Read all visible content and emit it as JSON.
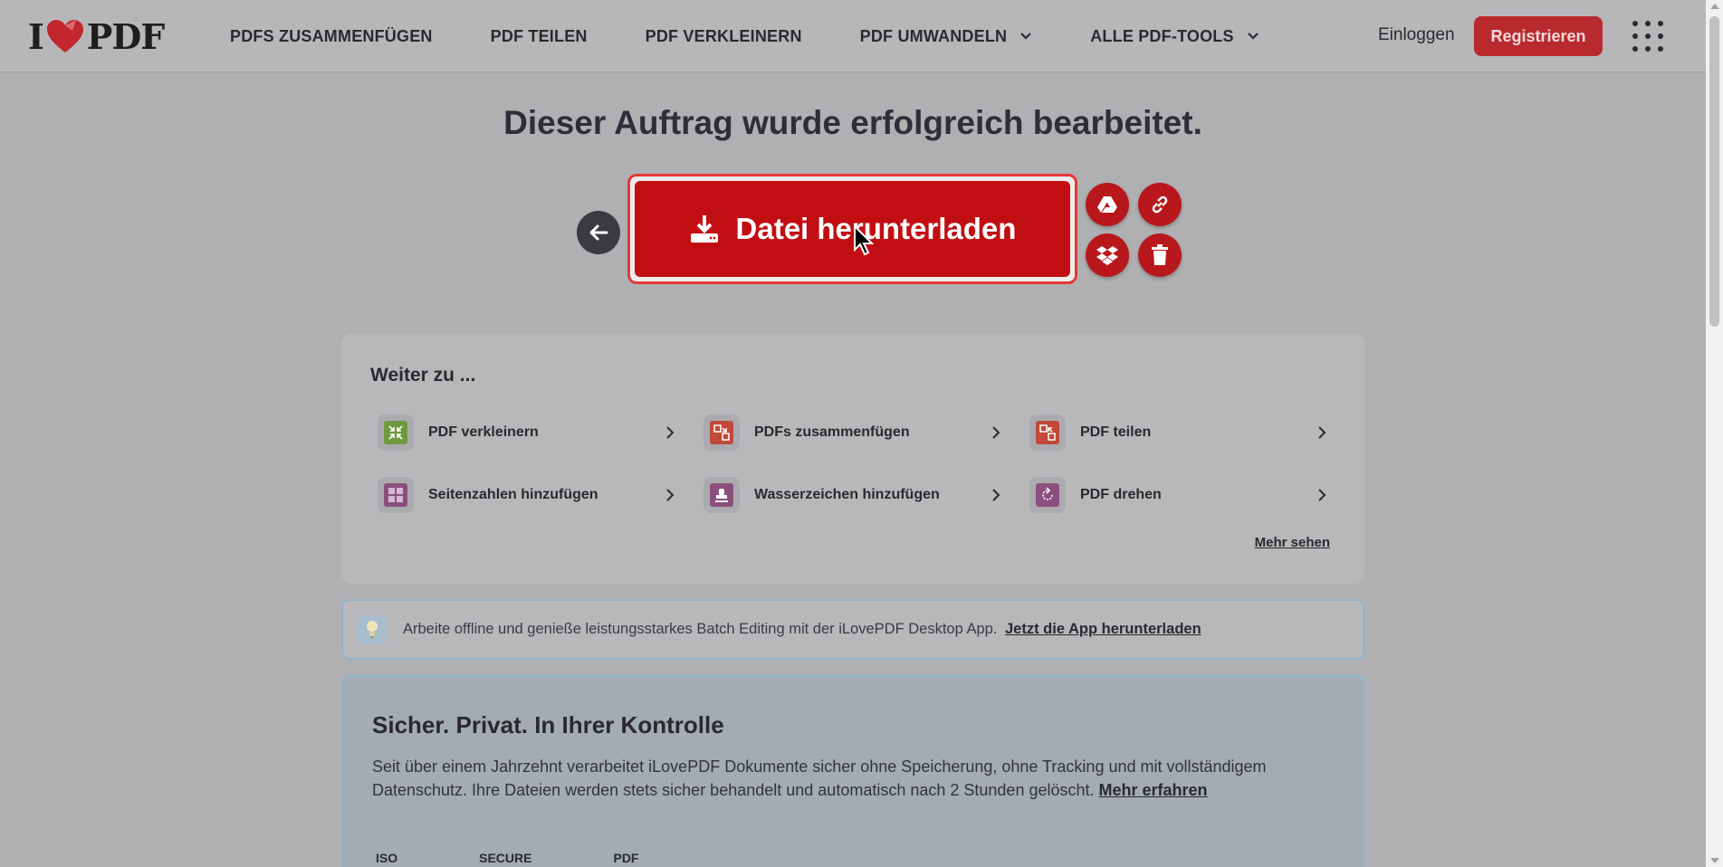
{
  "header": {
    "logo_left": "I",
    "logo_right": "PDF",
    "nav": [
      {
        "label": "PDFS ZUSAMMENFÜGEN",
        "dropdown": false
      },
      {
        "label": "PDF TEILEN",
        "dropdown": false
      },
      {
        "label": "PDF VERKLEINERN",
        "dropdown": false
      },
      {
        "label": "PDF UMWANDELN",
        "dropdown": true
      },
      {
        "label": "ALLE PDF-TOOLS",
        "dropdown": true
      }
    ],
    "login": "Einloggen",
    "register": "Registrieren"
  },
  "main": {
    "title": "Dieser Auftrag wurde erfolgreich bearbeitet.",
    "download_label": "Datei herunterladen",
    "actions": [
      "google-drive-icon",
      "link-icon",
      "dropbox-icon",
      "trash-icon"
    ]
  },
  "continue": {
    "title": "Weiter zu ...",
    "tools": [
      {
        "label": "PDF verkleinern",
        "icon": "compress-icon",
        "color": "#6f9a40"
      },
      {
        "label": "PDFs zusammenfügen",
        "icon": "merge-icon",
        "color": "#c0493a"
      },
      {
        "label": "PDF teilen",
        "icon": "split-icon",
        "color": "#c0493a"
      },
      {
        "label": "Seitenzahlen hinzufügen",
        "icon": "page-numbers-icon",
        "color": "#8b4f7d"
      },
      {
        "label": "Wasserzeichen hinzufügen",
        "icon": "watermark-icon",
        "color": "#8b4f7d"
      },
      {
        "label": "PDF drehen",
        "icon": "rotate-icon",
        "color": "#8b4f7d"
      }
    ],
    "more": "Mehr sehen"
  },
  "banner": {
    "text": "Arbeite offline und genieße leistungsstarkes Batch Editing mit der iLovePDF Desktop App.",
    "link": "Jetzt die App herunterladen"
  },
  "secure": {
    "title": "Sicher. Privat. In Ihrer Kontrolle",
    "text": "Seit über einem Jahrzehnt verarbeitet iLovePDF Dokumente sicher ohne Speicherung, ohne Tracking und mit vollständigem Datenschutz. Ihre Dateien werden stets sicher behandelt und automatisch nach 2 Stunden gelöscht.",
    "link": "Mehr erfahren",
    "badges": [
      "ISO",
      "SECURE",
      "PDF"
    ]
  },
  "colors": {
    "accent": "#c10e12",
    "register_bg": "#b82a2e"
  }
}
